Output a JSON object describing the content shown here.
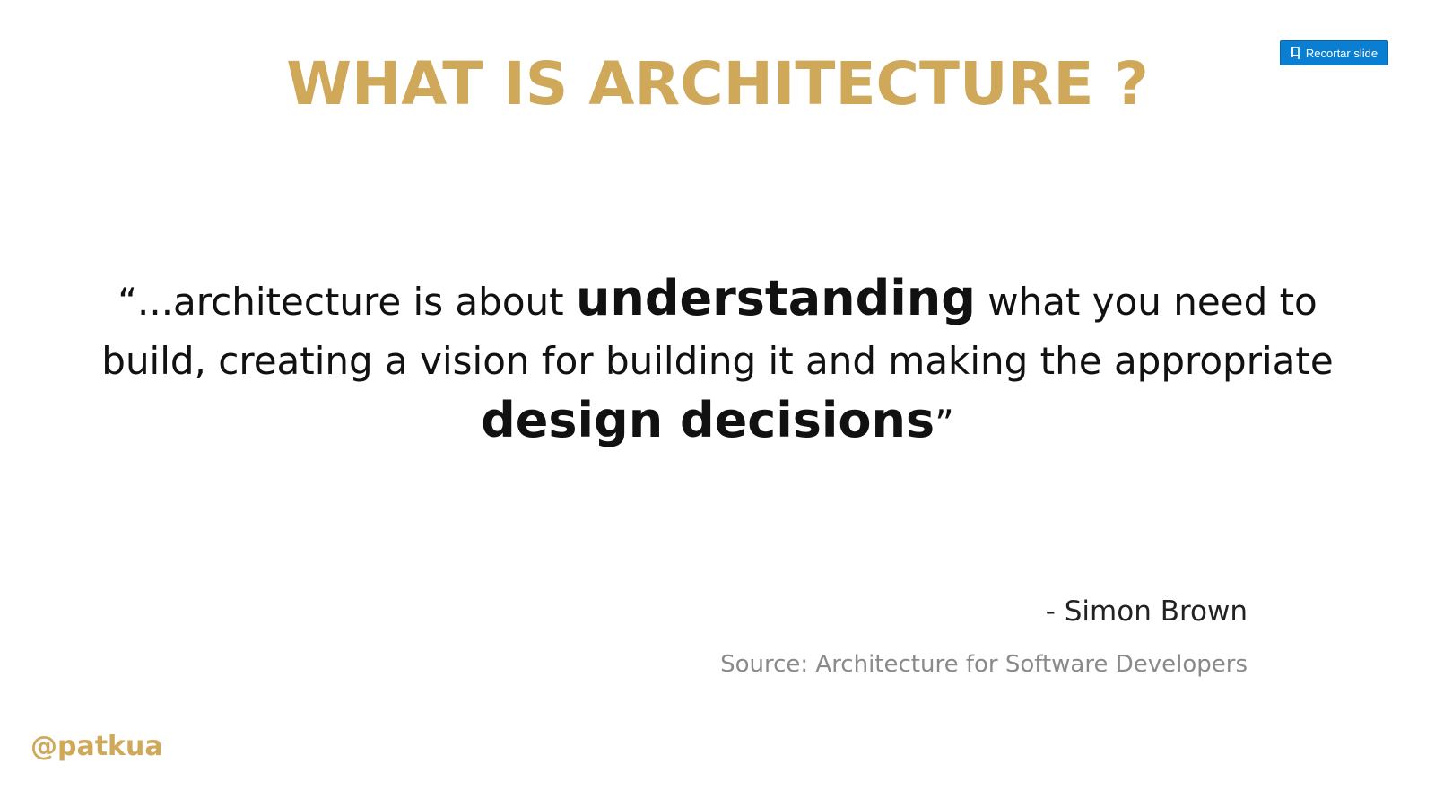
{
  "slide": {
    "title": "WHAT IS ARCHITECTURE ?",
    "quote": {
      "part1": "“...architecture is about ",
      "strong1": "understanding",
      "part2": " what you need to build, creating a vision for building it and making the appropriate ",
      "strong2": "design decisions",
      "part3": "”"
    },
    "author": "- Simon Brown",
    "source": "Source: Architecture for Software Developers",
    "handle": "@patkua"
  },
  "toolbar": {
    "clip_label": "Recortar slide",
    "clip_icon": "clip-slide-icon"
  },
  "colors": {
    "accent_gold": "#cfa85a",
    "button_blue": "#0a7fd1"
  }
}
